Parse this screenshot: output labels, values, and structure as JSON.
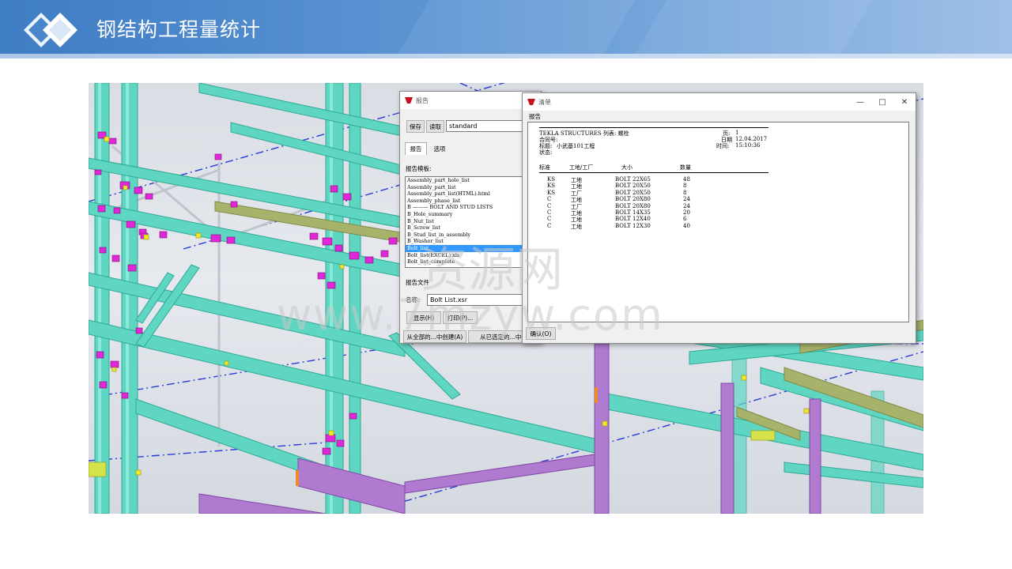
{
  "slide": {
    "title": "钢结构工程量统计"
  },
  "watermark": {
    "line1": "资源网",
    "line2": "www.7mzyw.com"
  },
  "report_dialog": {
    "title": "报告",
    "save_label": "保存",
    "load_label": "读取",
    "preset_value": "standard",
    "tabs": [
      "报告",
      "选项"
    ],
    "templates_label": "报告模板:",
    "templates": [
      "Assembly_part_hole_list",
      "Assembly_part_list",
      "Assembly_part_list(HTML).html",
      "Assembly_phase_list",
      "B ——— BOLT AND STUD LISTS",
      "B_Hole_summary",
      "B_Nut_list",
      "B_Screw_list",
      "B_Stud_list_in_assembly",
      "B_Washer_list",
      "Bolt_list",
      "Bolt_list(EXCEL).xls",
      "Bolt_list_complete"
    ],
    "selected_index": 10,
    "file_section_label": "报告文件",
    "name_label": "名称:",
    "name_value": "Bolt List.xsr",
    "show_label": "显示(H)",
    "print_label": "打印(P)...",
    "create_all_label": "从全部的...中创建(A)",
    "create_selected_label": "从已选定的...中创"
  },
  "list_dialog": {
    "title": "清单",
    "minimize_icon": "minimize-icon",
    "maximize_icon": "maximize-icon",
    "close_icon": "close-icon",
    "menu_label": "报告",
    "ok_label": "确认(O)",
    "report": {
      "header_left": "TEKLA STRUCTURES 列表: 螺栓",
      "page_label": "页:",
      "page_value": "1",
      "contract_label": "合同号:",
      "title_label": "标题:",
      "title_value": "小武基101工程",
      "status_label": "状态:",
      "date_label": "日期",
      "date_value": "12.04.2017",
      "time_label": "时间:",
      "time_value": "15:10:36",
      "columns": [
        "标准",
        "工地/工厂",
        "大小",
        "数量"
      ],
      "rows": [
        {
          "standard": "KS",
          "site": "工地",
          "size": "BOLT 22X65",
          "qty": "48"
        },
        {
          "standard": "KS",
          "site": "工地",
          "size": "BOLT 20X50",
          "qty": "8"
        },
        {
          "standard": "KS",
          "site": "工厂",
          "size": "BOLT 20X50",
          "qty": "8"
        },
        {
          "standard": "C",
          "site": "工地",
          "size": "BOLT 20X80",
          "qty": "24"
        },
        {
          "standard": "C",
          "site": "工厂",
          "size": "BOLT 20X80",
          "qty": "24"
        },
        {
          "standard": "C",
          "site": "工地",
          "size": "BOLT 14X35",
          "qty": "20"
        },
        {
          "standard": "C",
          "site": "工地",
          "size": "BOLT 12X40",
          "qty": "6"
        },
        {
          "standard": "C",
          "site": "工地",
          "size": "BOLT 12X30",
          "qty": "40"
        }
      ]
    }
  },
  "colors": {
    "banner": "#4a86cb",
    "steel_teal": "#5fd6c2",
    "steel_purple": "#b07ad0",
    "bolt_magenta": "#e028d8",
    "gridline_blue": "#2a3ad8",
    "selection": "#3399ff"
  }
}
